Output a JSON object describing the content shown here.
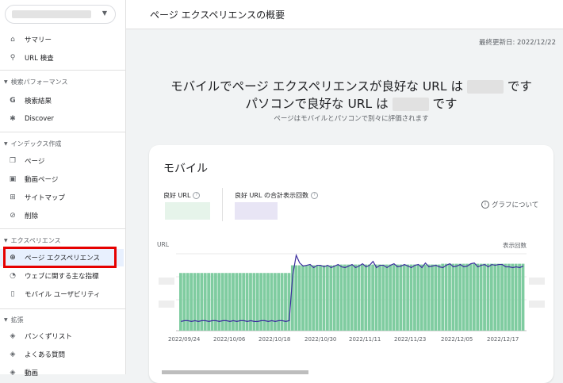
{
  "page": {
    "title": "ページ エクスペリエンスの概要",
    "last_updated": "最終更新日: 2022/12/22"
  },
  "sidebar": {
    "top_items": [
      {
        "label": "サマリー",
        "icon": "home-icon"
      },
      {
        "label": "URL 検査",
        "icon": "search-icon"
      }
    ],
    "sections": [
      {
        "label": "検索パフォーマンス",
        "items": [
          {
            "label": "検索結果",
            "icon": "google-g-icon"
          },
          {
            "label": "Discover",
            "icon": "asterisk-icon"
          }
        ]
      },
      {
        "label": "インデックス作成",
        "items": [
          {
            "label": "ページ",
            "icon": "pages-icon"
          },
          {
            "label": "動画ページ",
            "icon": "video-page-icon"
          },
          {
            "label": "サイトマップ",
            "icon": "sitemap-icon"
          },
          {
            "label": "削除",
            "icon": "visibility-off-icon"
          }
        ]
      },
      {
        "label": "エクスペリエンス",
        "items": [
          {
            "label": "ページ エクスペリエンス",
            "icon": "add-circle-icon",
            "active": true
          },
          {
            "label": "ウェブに関する主な指標",
            "icon": "speed-icon"
          },
          {
            "label": "モバイル ユーザビリティ",
            "icon": "smartphone-icon"
          }
        ]
      },
      {
        "label": "拡張",
        "items": [
          {
            "label": "パンくずリスト",
            "icon": "layers-icon"
          },
          {
            "label": "よくある質問",
            "icon": "layers-icon"
          },
          {
            "label": "動画",
            "icon": "layers-icon"
          }
        ]
      }
    ]
  },
  "summary": {
    "mobile_line_pre": "モバイルでページ エクスペリエンスが良好な",
    "url_word": "URL は",
    "mobile_line_post": "です",
    "desktop_line_pre": "パソコンで良好な",
    "desktop_line_post": "です",
    "note": "ページはモバイルとパソコンで別々に評価されます"
  },
  "mobile_card": {
    "title": "モバイル",
    "metric1_label": "良好 URL",
    "metric2_label": "良好 URL の合計表示回数",
    "graph_about": "グラフについて",
    "left_axis_title": "URL",
    "right_axis_title": "表示回数"
  },
  "chart_data": {
    "type": "bar",
    "title": "",
    "xlabel": "",
    "ylabel": "URL",
    "y2label": "表示回数",
    "x_tick_labels": [
      "2022/09/24",
      "2022/10/06",
      "2022/10/18",
      "2022/10/30",
      "2022/11/11",
      "2022/11/23",
      "2022/12/05",
      "2022/12/17"
    ],
    "bar_color": "#7fcca0",
    "line_color": "#3c2f9e",
    "series": [
      {
        "name": "良好 URL",
        "relative_values": [
          0.75,
          0.75,
          0.75,
          0.75,
          0.75,
          0.75,
          0.75,
          0.75,
          0.75,
          0.75,
          0.75,
          0.75,
          0.75,
          0.75,
          0.75,
          0.75,
          0.75,
          0.75,
          0.75,
          0.75,
          0.75,
          0.75,
          0.75,
          0.75,
          0.75,
          0.75,
          0.75,
          0.75,
          0.75,
          0.75,
          0.75,
          0.75,
          0.85,
          0.85,
          0.85,
          0.85,
          0.85,
          0.85,
          0.85,
          0.85,
          0.85,
          0.85,
          0.85,
          0.85,
          0.85,
          0.85,
          0.86,
          0.86,
          0.86,
          0.86,
          0.86,
          0.86,
          0.86,
          0.86,
          0.86,
          0.86,
          0.86,
          0.86,
          0.86,
          0.86,
          0.86,
          0.86,
          0.86,
          0.86,
          0.86,
          0.86,
          0.86,
          0.86,
          0.86,
          0.86,
          0.86,
          0.86,
          0.86,
          0.86,
          0.86,
          0.87,
          0.87,
          0.87,
          0.87,
          0.87,
          0.87,
          0.87,
          0.87,
          0.87,
          0.87,
          0.87,
          0.87,
          0.87,
          0.87,
          0.87,
          0.87,
          0.87,
          0.87,
          0.87,
          0.87,
          0.87,
          0.87,
          0.87,
          0.87
        ]
      },
      {
        "name": "良好 URL の合計表示回数",
        "relative_values": [
          0.12,
          0.13,
          0.13,
          0.12,
          0.13,
          0.12,
          0.13,
          0.13,
          0.12,
          0.13,
          0.13,
          0.12,
          0.13,
          0.13,
          0.12,
          0.13,
          0.12,
          0.13,
          0.13,
          0.12,
          0.13,
          0.12,
          0.12,
          0.13,
          0.13,
          0.12,
          0.13,
          0.12,
          0.13,
          0.13,
          0.12,
          0.13,
          0.72,
          0.98,
          0.88,
          0.84,
          0.85,
          0.86,
          0.82,
          0.85,
          0.85,
          0.83,
          0.85,
          0.82,
          0.84,
          0.86,
          0.83,
          0.82,
          0.84,
          0.86,
          0.82,
          0.84,
          0.87,
          0.83,
          0.85,
          0.9,
          0.82,
          0.85,
          0.85,
          0.82,
          0.85,
          0.87,
          0.83,
          0.84,
          0.86,
          0.84,
          0.82,
          0.85,
          0.86,
          0.82,
          0.88,
          0.83,
          0.84,
          0.85,
          0.83,
          0.82,
          0.85,
          0.87,
          0.83,
          0.84,
          0.86,
          0.83,
          0.84,
          0.87,
          0.88,
          0.83,
          0.85,
          0.86,
          0.83,
          0.86,
          0.85,
          0.86,
          0.86,
          0.83,
          0.83,
          0.82,
          0.83,
          0.82,
          0.84
        ]
      }
    ]
  }
}
